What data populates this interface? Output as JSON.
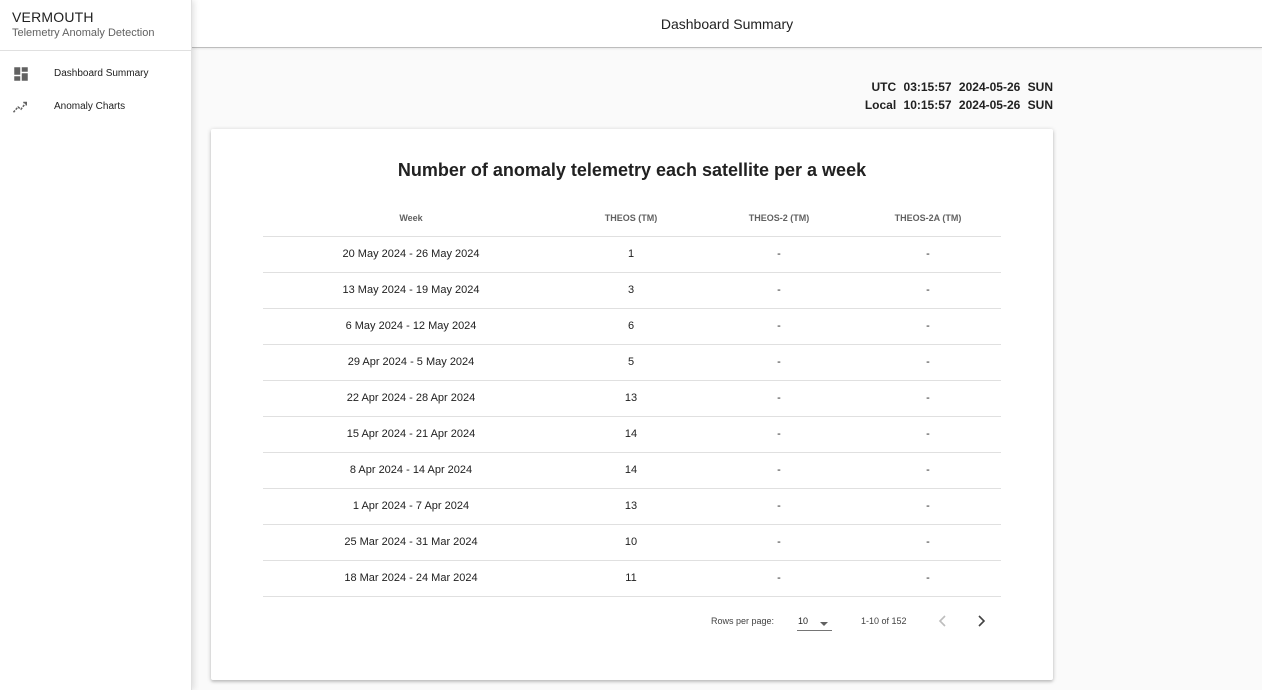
{
  "app": {
    "name": "VERMOUTH",
    "subtitle": "Telemetry Anomaly Detection"
  },
  "sidebar": {
    "items": [
      {
        "label": "Dashboard Summary",
        "icon": "dashboard-icon"
      },
      {
        "label": "Anomaly Charts",
        "icon": "trending-chart-icon"
      }
    ]
  },
  "header": {
    "title": "Dashboard Summary"
  },
  "clock": {
    "utc_label": "UTC",
    "utc_time": "03:15:57",
    "utc_date": "2024-05-26",
    "utc_day": "SUN",
    "local_label": "Local",
    "local_time": "10:15:57",
    "local_date": "2024-05-26",
    "local_day": "SUN"
  },
  "card": {
    "title": "Number of anomaly telemetry each satellite per a week",
    "columns": [
      "Week",
      "THEOS (TM)",
      "THEOS-2 (TM)",
      "THEOS-2A (TM)"
    ],
    "rows": [
      [
        "20 May 2024 - 26 May 2024",
        "1",
        "-",
        "-"
      ],
      [
        "13 May 2024 - 19 May 2024",
        "3",
        "-",
        "-"
      ],
      [
        "6 May 2024 - 12 May 2024",
        "6",
        "-",
        "-"
      ],
      [
        "29 Apr 2024 - 5 May 2024",
        "5",
        "-",
        "-"
      ],
      [
        "22 Apr 2024 - 28 Apr 2024",
        "13",
        "-",
        "-"
      ],
      [
        "15 Apr 2024 - 21 Apr 2024",
        "14",
        "-",
        "-"
      ],
      [
        "8 Apr 2024 - 14 Apr 2024",
        "14",
        "-",
        "-"
      ],
      [
        "1 Apr 2024 - 7 Apr 2024",
        "13",
        "-",
        "-"
      ],
      [
        "25 Mar 2024 - 31 Mar 2024",
        "10",
        "-",
        "-"
      ],
      [
        "18 Mar 2024 - 24 Mar 2024",
        "11",
        "-",
        "-"
      ]
    ]
  },
  "pagination": {
    "rows_per_page_label": "Rows per page:",
    "rows_per_page_value": "10",
    "range_text": "1-10 of 152"
  },
  "colors": {
    "text_primary": "#212121",
    "text_secondary": "#616161",
    "divider": "#e0e0e0",
    "icon": "#616161",
    "background": "#fafafa",
    "surface": "#ffffff"
  }
}
